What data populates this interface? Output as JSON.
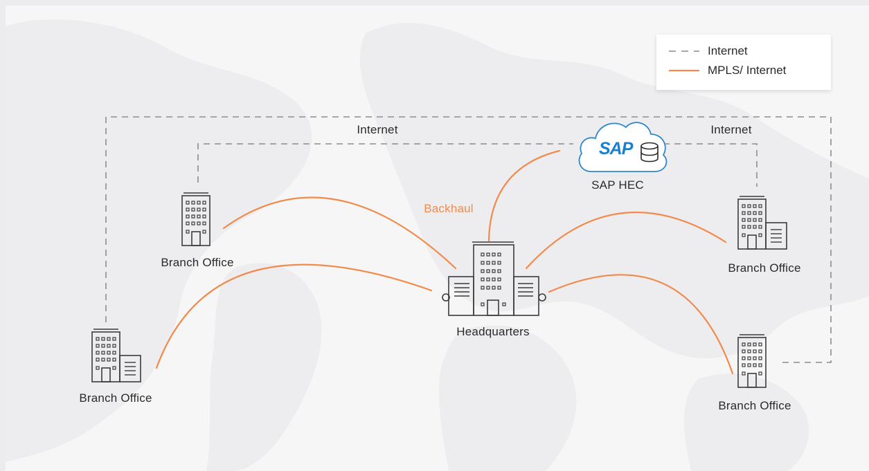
{
  "colors": {
    "accent": "#f28a4c",
    "dashed_line": "#8c8c8c",
    "building": "#3a3a3a",
    "cloud": "#2f86c9",
    "sap_blue": "#1a7fcf",
    "background": "#f6f6f7",
    "map_land": "#ededef"
  },
  "legend": {
    "items": [
      {
        "style": "dashed",
        "label": "Internet"
      },
      {
        "style": "solid",
        "label": "MPLS/ Internet"
      }
    ]
  },
  "cloud": {
    "logo_text": "SAP",
    "label": "SAP HEC",
    "icon": "database-icon"
  },
  "labels": {
    "internet_left": "Internet",
    "internet_right": "Internet",
    "backhaul": "Backhaul"
  },
  "nodes": {
    "hq": {
      "label": "Headquarters",
      "icon": "headquarters-building-icon"
    },
    "branch_top_left": {
      "label": "Branch Office",
      "icon": "office-building-icon"
    },
    "branch_bottom_left": {
      "label": "Branch Office",
      "icon": "office-building-icon"
    },
    "branch_top_right": {
      "label": "Branch Office",
      "icon": "office-building-icon"
    },
    "branch_bottom_right": {
      "label": "Branch Office",
      "icon": "office-building-icon"
    }
  }
}
